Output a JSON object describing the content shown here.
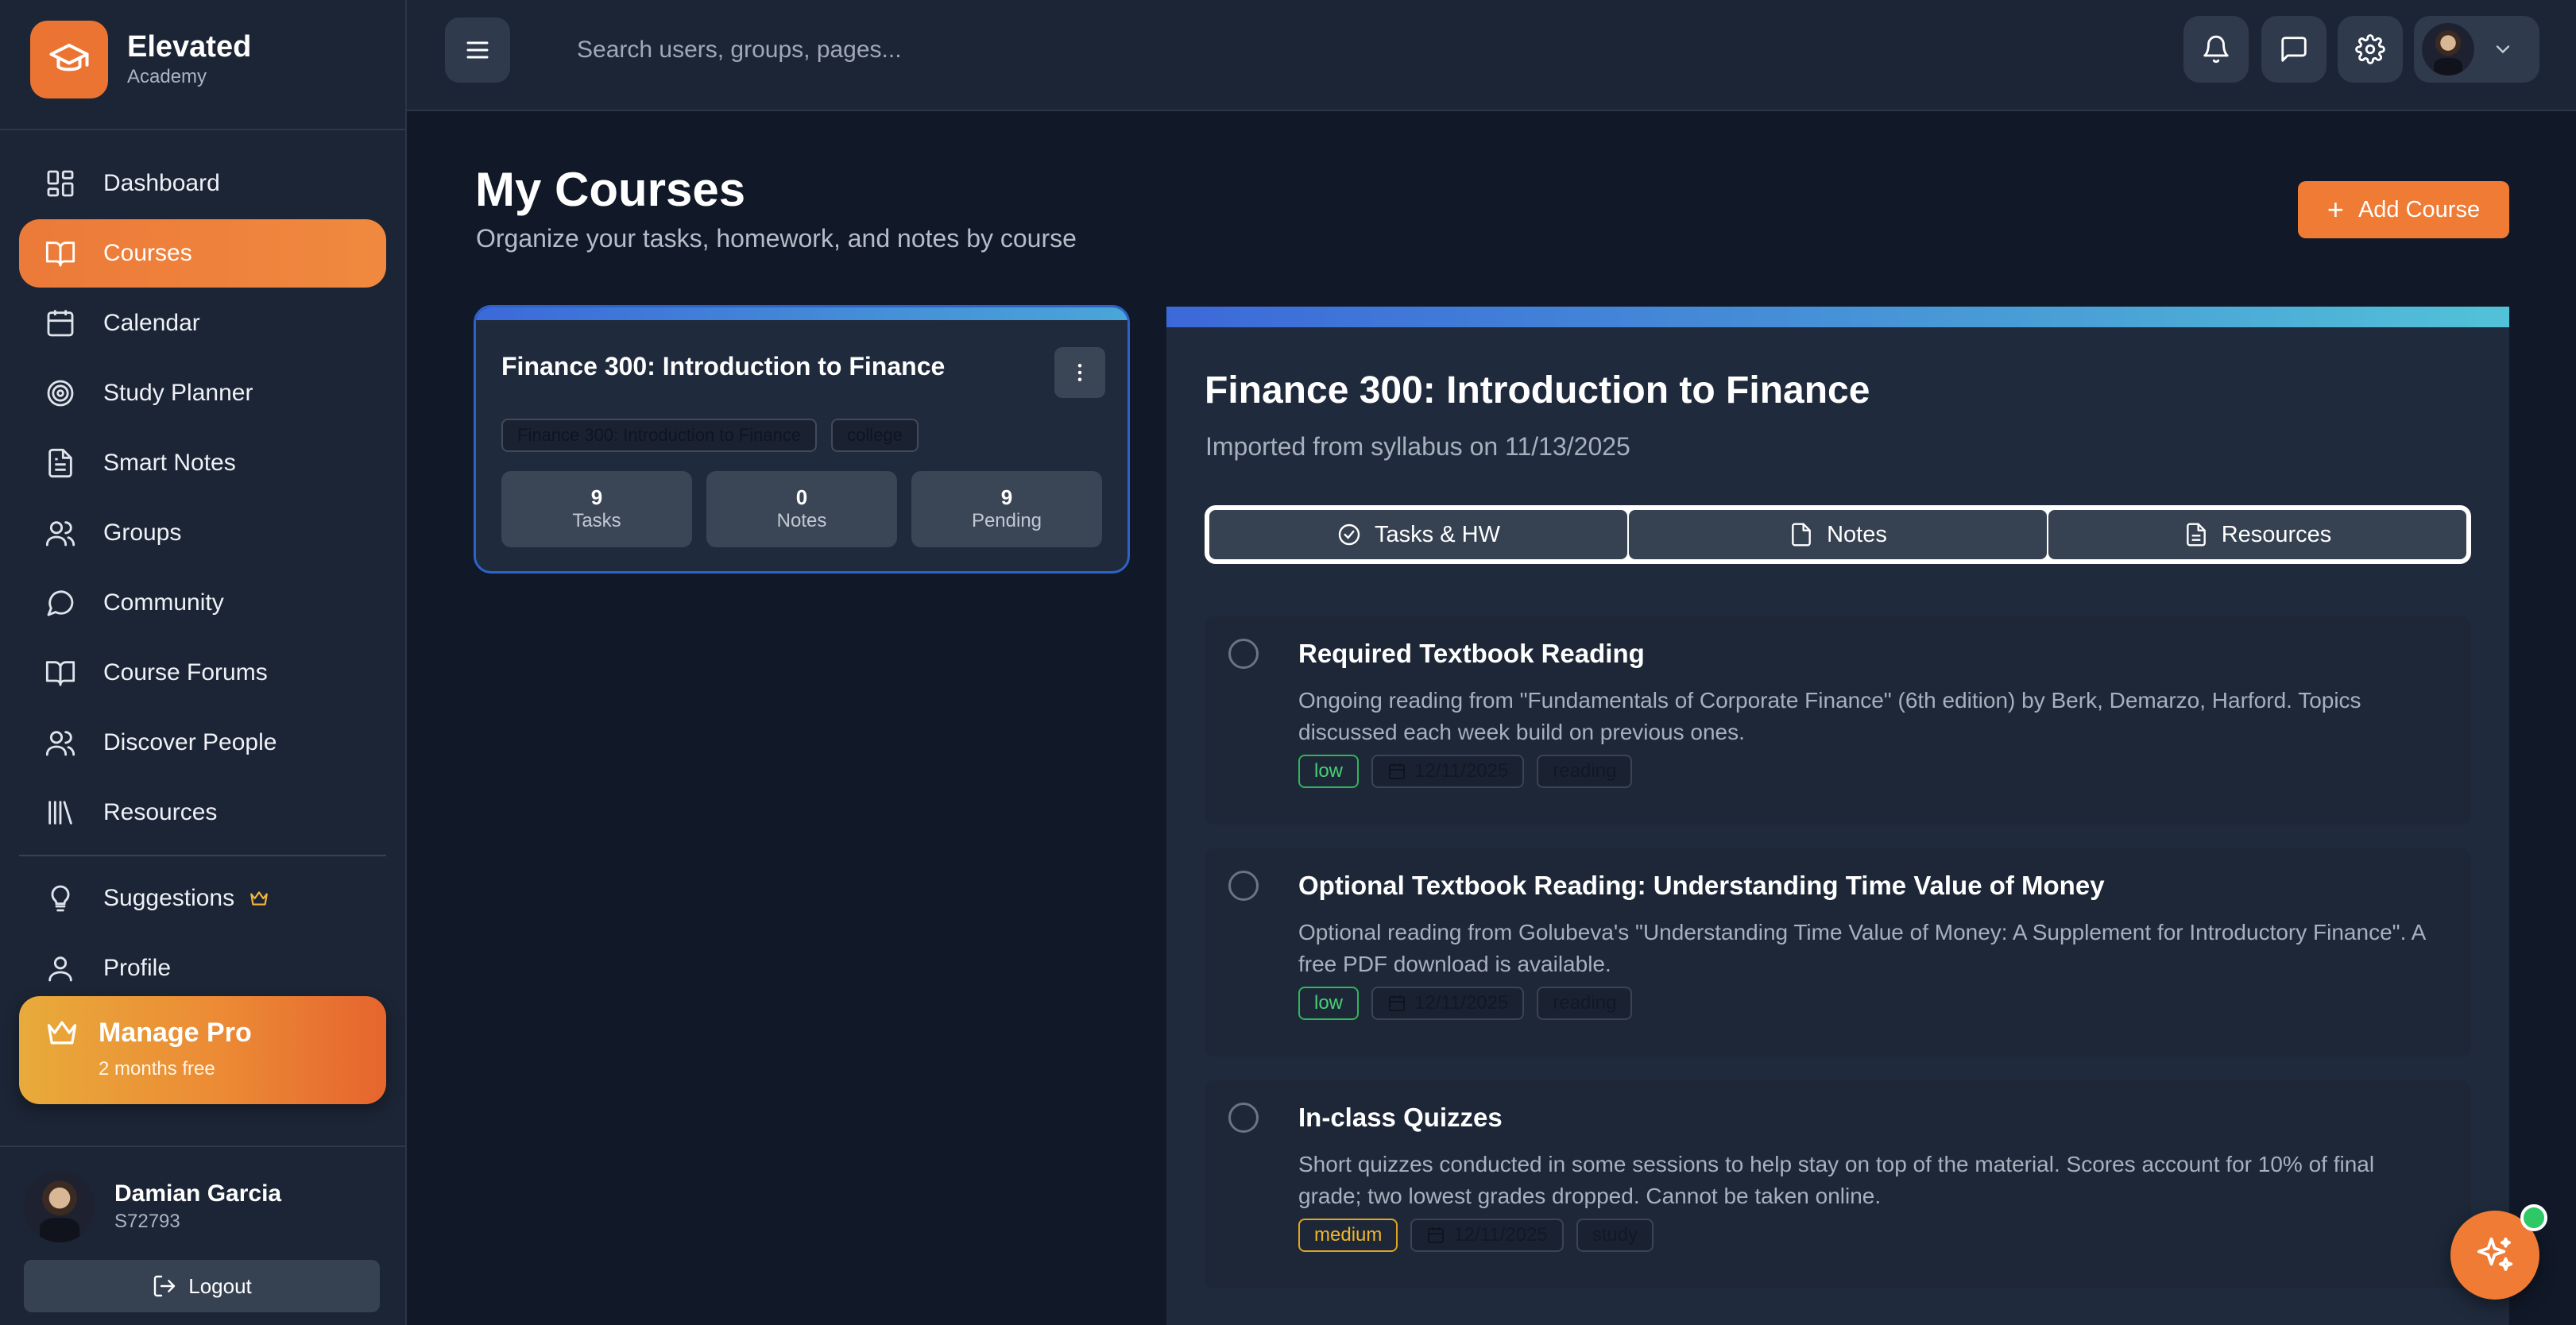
{
  "brand": {
    "name": "Elevated",
    "subtitle": "Academy",
    "logo_icon": "graduation-cap-icon"
  },
  "sidebar": {
    "items": [
      {
        "label": "Dashboard",
        "icon": "dashboard-grid-icon",
        "active": false
      },
      {
        "label": "Courses",
        "icon": "book-open-icon",
        "active": true
      },
      {
        "label": "Calendar",
        "icon": "calendar-icon",
        "active": false
      },
      {
        "label": "Study Planner",
        "icon": "target-icon",
        "active": false
      },
      {
        "label": "Smart Notes",
        "icon": "document-icon",
        "active": false
      },
      {
        "label": "Groups",
        "icon": "users-icon",
        "active": false
      },
      {
        "label": "Community",
        "icon": "chat-bubble-icon",
        "active": false
      },
      {
        "label": "Course Forums",
        "icon": "book-open-icon",
        "active": false
      },
      {
        "label": "Discover People",
        "icon": "users-icon",
        "active": false
      },
      {
        "label": "Resources",
        "icon": "library-icon",
        "active": false
      }
    ],
    "secondary": [
      {
        "label": "Suggestions",
        "icon": "lightbulb-icon",
        "badge_icon": "crown-icon"
      },
      {
        "label": "Profile",
        "icon": "user-icon"
      }
    ],
    "pro": {
      "title": "Manage Pro",
      "subtitle": "2 months free"
    },
    "user": {
      "name": "Damian Garcia",
      "id": "S72793"
    },
    "logout_label": "Logout"
  },
  "topbar": {
    "search_placeholder": "Search users, groups, pages..."
  },
  "page": {
    "title": "My Courses",
    "subtitle": "Organize your tasks, homework, and notes by course",
    "add_button": "Add Course"
  },
  "course_card": {
    "title": "Finance 300: Introduction to Finance",
    "tags": [
      "Finance 300: Introduction to Finance",
      "college"
    ],
    "stats": [
      {
        "value": "9",
        "label": "Tasks"
      },
      {
        "value": "0",
        "label": "Notes"
      },
      {
        "value": "9",
        "label": "Pending"
      }
    ]
  },
  "detail": {
    "title": "Finance 300: Introduction to Finance",
    "subtitle": "Imported from syllabus on 11/13/2025",
    "tabs": [
      {
        "label": "Tasks & HW",
        "icon": "check-circle-icon"
      },
      {
        "label": "Notes",
        "icon": "file-icon"
      },
      {
        "label": "Resources",
        "icon": "file-text-icon"
      }
    ],
    "tasks": [
      {
        "title": "Required Textbook Reading",
        "description": "Ongoing reading from \"Fundamentals of Corporate Finance\" (6th edition) by Berk, Demarzo, Harford. Topics discussed each week build on previous ones.",
        "priority": "low",
        "date": "12/11/2025",
        "category": "reading"
      },
      {
        "title": "Optional Textbook Reading: Understanding Time Value of Money",
        "description": "Optional reading from Golubeva's \"Understanding Time Value of Money: A Supplement for Introductory Finance\". A free PDF download is available.",
        "priority": "low",
        "date": "12/11/2025",
        "category": "reading"
      },
      {
        "title": "In-class Quizzes",
        "description": "Short quizzes conducted in some sessions to help stay on top of the material. Scores account for 10% of final grade; two lowest grades dropped. Cannot be taken online.",
        "priority": "medium",
        "date": "12/11/2025",
        "category": "study"
      }
    ]
  },
  "colors": {
    "accent": "#ef7b35",
    "background": "#111827",
    "sidebar": "#1c2535",
    "card": "#1f2a3c",
    "low": "#48d075",
    "medium": "#f0b62a"
  }
}
